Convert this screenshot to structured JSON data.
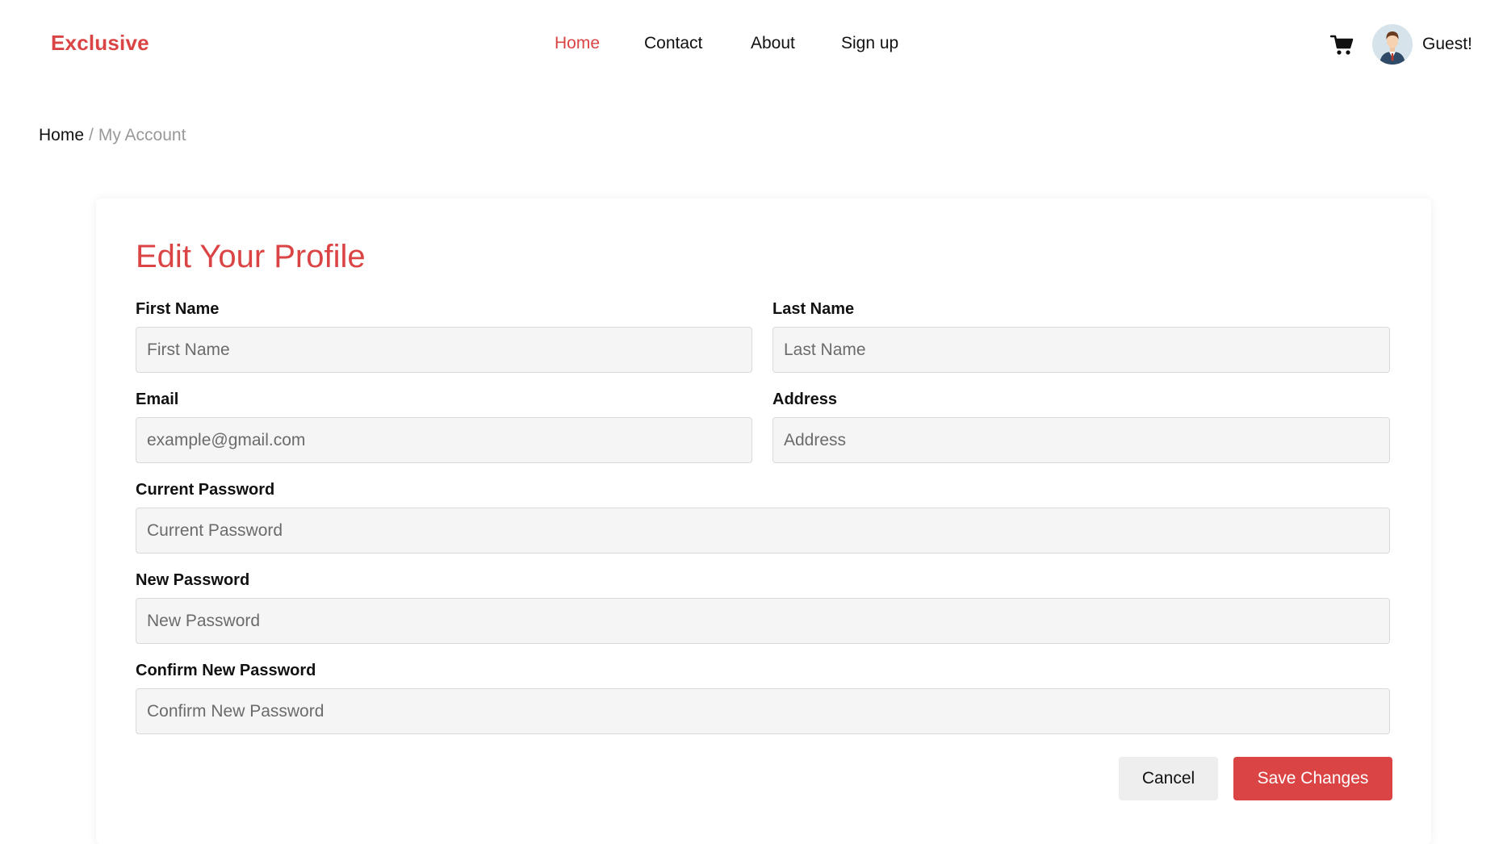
{
  "header": {
    "brand": "Exclusive",
    "nav": [
      {
        "label": "Home",
        "active": true
      },
      {
        "label": "Contact",
        "active": false
      },
      {
        "label": "About",
        "active": false
      },
      {
        "label": "Sign up",
        "active": false
      }
    ],
    "cart_icon": "shopping-cart-icon",
    "avatar_icon": "user-avatar-icon",
    "greeting": "Guest!"
  },
  "breadcrumb": {
    "home": "Home",
    "separator": "/",
    "current": "My Account"
  },
  "profile": {
    "title": "Edit Your Profile",
    "fields": {
      "first_name": {
        "label": "First Name",
        "placeholder": "First Name",
        "value": ""
      },
      "last_name": {
        "label": "Last Name",
        "placeholder": "Last Name",
        "value": ""
      },
      "email": {
        "label": "Email",
        "placeholder": "example@gmail.com",
        "value": ""
      },
      "address": {
        "label": "Address",
        "placeholder": "Address",
        "value": ""
      },
      "current_password": {
        "label": "Current Password",
        "placeholder": "Current Password",
        "value": ""
      },
      "new_password": {
        "label": "New Password",
        "placeholder": "New Password",
        "value": ""
      },
      "confirm_password": {
        "label": "Confirm New Password",
        "placeholder": "Confirm New Password",
        "value": ""
      }
    },
    "buttons": {
      "cancel": "Cancel",
      "save": "Save Changes"
    }
  },
  "colors": {
    "accent": "#db4444",
    "input_bg": "#f5f5f5",
    "cancel_bg": "#eeeeee"
  }
}
